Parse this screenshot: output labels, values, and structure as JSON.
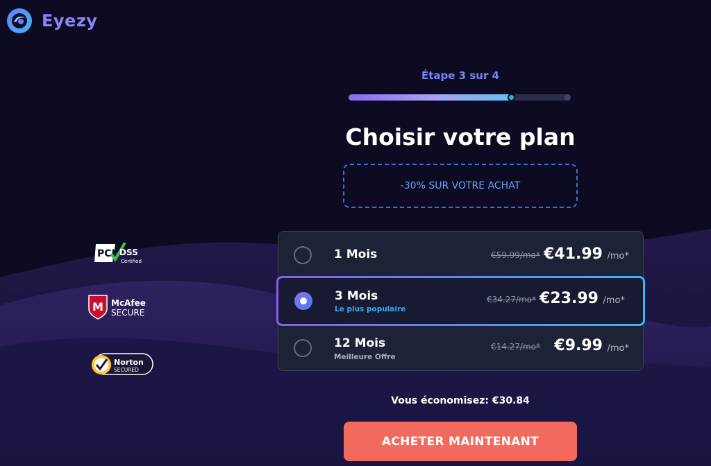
{
  "brand": {
    "name": "Eyezy",
    "logo_icon": "eye-swirl-icon",
    "colors": {
      "logo_text": "#8b86f5",
      "accent_purple": "#8a5cf0",
      "accent_blue": "#35b8f5",
      "cta": "#f26a5e",
      "background": "#0d0b22"
    }
  },
  "progress": {
    "label": "Étape 3 sur 4",
    "current_step": 3,
    "total_steps": 4,
    "fill_fraction": 0.73
  },
  "page_title": "Choisir votre plan",
  "discount_banner": "-30% SUR VOTRE ACHAT",
  "trust_badges": [
    {
      "name": "pci-dss-certified-logo",
      "text_main": "DSS",
      "text_sub": "Certified"
    },
    {
      "name": "mcafee-secure-logo",
      "text_main": "McAfee",
      "text_sub": "SECURE"
    },
    {
      "name": "norton-secured-logo",
      "text_main": "Norton",
      "text_sub": "SECURED"
    }
  ],
  "plans": [
    {
      "name": "1 Mois",
      "subtitle": "",
      "old_price": "€59.99/mo*",
      "price": "€41.99",
      "per": "/mo*",
      "selected": false
    },
    {
      "name": "3 Mois",
      "subtitle": "Le plus populaire",
      "old_price": "€34.27/mo*",
      "price": "€23.99",
      "per": "/mo*",
      "selected": true
    },
    {
      "name": "12 Mois",
      "subtitle": "Meilleure Offre",
      "old_price": "€14.27/mo*",
      "price": "€9.99",
      "per": "/mo*",
      "selected": false
    }
  ],
  "savings_text": "Vous économisez: €30.84",
  "cta_label": "ACHETER MAINTENANT"
}
